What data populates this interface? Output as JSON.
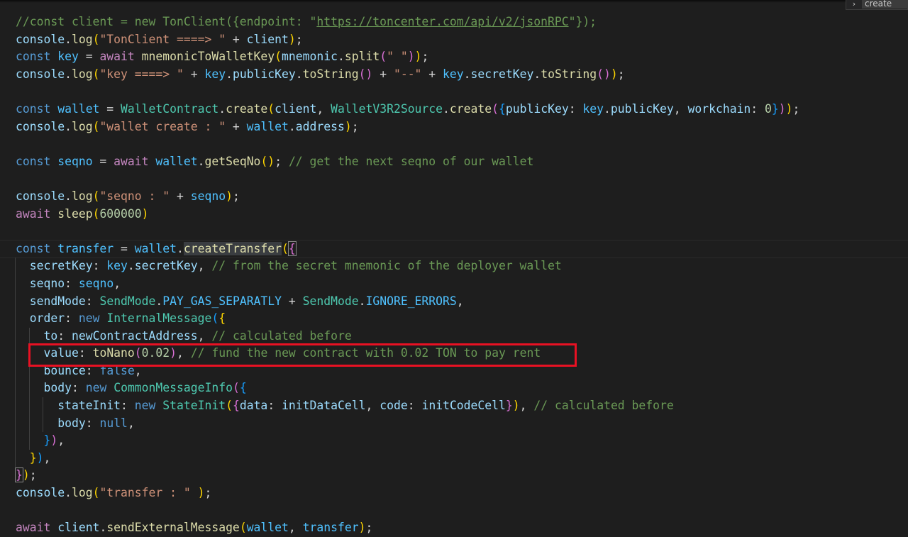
{
  "find_widget": {
    "toggle_icon": "chevron-right-icon",
    "value": "create"
  },
  "colors": {
    "background": "#1e1e1e",
    "comment": "#6a9955",
    "keyword": "#569cd6",
    "control": "#c586c0",
    "variable": "#9cdcfe",
    "constant": "#4fc1ff",
    "function": "#dcdcaa",
    "class": "#4ec9b0",
    "string": "#ce9178",
    "number": "#b5cea8",
    "highlight_box": "#e81123"
  },
  "code_lines": [
    [
      [
        "cm",
        "//const client = new TonClient({endpoint: \""
      ],
      [
        "cm ul",
        "https://toncenter.com/api/v2/jsonRPC"
      ],
      [
        "cm",
        "\"});"
      ]
    ],
    [
      [
        "var",
        "console"
      ],
      [
        "pl",
        "."
      ],
      [
        "fn",
        "log"
      ],
      [
        "b1",
        "("
      ],
      [
        "str",
        "\"TonClient ====> \""
      ],
      [
        "pl",
        " + "
      ],
      [
        "var",
        "client"
      ],
      [
        "b1",
        ")"
      ],
      [
        "pl",
        ";"
      ]
    ],
    [
      [
        "kw",
        "const "
      ],
      [
        "const",
        "key"
      ],
      [
        "pl",
        " = "
      ],
      [
        "ctl",
        "await "
      ],
      [
        "fn",
        "mnemonicToWalletKey"
      ],
      [
        "b1",
        "("
      ],
      [
        "var",
        "mnemonic"
      ],
      [
        "pl",
        "."
      ],
      [
        "fn",
        "split"
      ],
      [
        "b2",
        "("
      ],
      [
        "str",
        "\" \""
      ],
      [
        "b2",
        ")"
      ],
      [
        "b1",
        ")"
      ],
      [
        "pl",
        ";"
      ]
    ],
    [
      [
        "var",
        "console"
      ],
      [
        "pl",
        "."
      ],
      [
        "fn",
        "log"
      ],
      [
        "b1",
        "("
      ],
      [
        "str",
        "\"key ====> \""
      ],
      [
        "pl",
        " + "
      ],
      [
        "const",
        "key"
      ],
      [
        "pl",
        "."
      ],
      [
        "var",
        "publicKey"
      ],
      [
        "pl",
        "."
      ],
      [
        "fn",
        "toString"
      ],
      [
        "b2",
        "()"
      ],
      [
        "pl",
        " + "
      ],
      [
        "str",
        "\"--\""
      ],
      [
        "pl",
        " + "
      ],
      [
        "const",
        "key"
      ],
      [
        "pl",
        "."
      ],
      [
        "var",
        "secretKey"
      ],
      [
        "pl",
        "."
      ],
      [
        "fn",
        "toString"
      ],
      [
        "b2",
        "()"
      ],
      [
        "b1",
        ")"
      ],
      [
        "pl",
        ";"
      ]
    ],
    [],
    [
      [
        "kw",
        "const "
      ],
      [
        "const",
        "wallet"
      ],
      [
        "pl",
        " = "
      ],
      [
        "cls",
        "WalletContract"
      ],
      [
        "pl",
        "."
      ],
      [
        "fn",
        "create"
      ],
      [
        "b1",
        "("
      ],
      [
        "var",
        "client"
      ],
      [
        "pl",
        ", "
      ],
      [
        "cls",
        "WalletV3R2Source"
      ],
      [
        "pl",
        "."
      ],
      [
        "fn",
        "create"
      ],
      [
        "b2",
        "("
      ],
      [
        "b3",
        "{"
      ],
      [
        "var",
        "publicKey"
      ],
      [
        "pl",
        ": "
      ],
      [
        "const",
        "key"
      ],
      [
        "pl",
        "."
      ],
      [
        "var",
        "publicKey"
      ],
      [
        "pl",
        ", "
      ],
      [
        "var",
        "workchain"
      ],
      [
        "pl",
        ": "
      ],
      [
        "num",
        "0"
      ],
      [
        "b3",
        "}"
      ],
      [
        "b2",
        ")"
      ],
      [
        "b1",
        ")"
      ],
      [
        "pl",
        ";"
      ]
    ],
    [
      [
        "var",
        "console"
      ],
      [
        "pl",
        "."
      ],
      [
        "fn",
        "log"
      ],
      [
        "b1",
        "("
      ],
      [
        "str",
        "\"wallet create : \""
      ],
      [
        "pl",
        " + "
      ],
      [
        "const",
        "wallet"
      ],
      [
        "pl",
        "."
      ],
      [
        "var",
        "address"
      ],
      [
        "b1",
        ")"
      ],
      [
        "pl",
        ";"
      ]
    ],
    [],
    [
      [
        "kw",
        "const "
      ],
      [
        "const",
        "seqno"
      ],
      [
        "pl",
        " = "
      ],
      [
        "ctl",
        "await "
      ],
      [
        "const",
        "wallet"
      ],
      [
        "pl",
        "."
      ],
      [
        "fn",
        "getSeqNo"
      ],
      [
        "b1",
        "()"
      ],
      [
        "pl",
        "; "
      ],
      [
        "cm",
        "// get the next seqno of our wallet"
      ]
    ],
    [],
    [
      [
        "var",
        "console"
      ],
      [
        "pl",
        "."
      ],
      [
        "fn",
        "log"
      ],
      [
        "b1",
        "("
      ],
      [
        "str",
        "\"seqno : \""
      ],
      [
        "pl",
        " + "
      ],
      [
        "const",
        "seqno"
      ],
      [
        "b1",
        ")"
      ],
      [
        "pl",
        ";"
      ]
    ],
    [
      [
        "ctl",
        "await "
      ],
      [
        "fn",
        "sleep"
      ],
      [
        "b1",
        "("
      ],
      [
        "num",
        "600000"
      ],
      [
        "b1",
        ")"
      ]
    ],
    [],
    [
      [
        "kw",
        "const "
      ],
      [
        "const",
        "transfer"
      ],
      [
        "pl",
        " = "
      ],
      [
        "const",
        "wallet"
      ],
      [
        "pl",
        "."
      ],
      [
        "fn wordhl",
        "createTransfer"
      ],
      [
        "b1",
        "("
      ],
      [
        "b2 match",
        "{"
      ]
    ],
    [
      [
        "pl",
        "  "
      ],
      [
        "var",
        "secretKey"
      ],
      [
        "pl",
        ": "
      ],
      [
        "const",
        "key"
      ],
      [
        "pl",
        "."
      ],
      [
        "var",
        "secretKey"
      ],
      [
        "pl",
        ", "
      ],
      [
        "cm",
        "// from the secret mnemonic of the deployer wallet"
      ]
    ],
    [
      [
        "pl",
        "  "
      ],
      [
        "var",
        "seqno"
      ],
      [
        "pl",
        ": "
      ],
      [
        "const",
        "seqno"
      ],
      [
        "pl",
        ","
      ]
    ],
    [
      [
        "pl",
        "  "
      ],
      [
        "var",
        "sendMode"
      ],
      [
        "pl",
        ": "
      ],
      [
        "cls",
        "SendMode"
      ],
      [
        "pl",
        "."
      ],
      [
        "const",
        "PAY_GAS_SEPARATLY"
      ],
      [
        "pl",
        " + "
      ],
      [
        "cls",
        "SendMode"
      ],
      [
        "pl",
        "."
      ],
      [
        "const",
        "IGNORE_ERRORS"
      ],
      [
        "pl",
        ","
      ]
    ],
    [
      [
        "pl",
        "  "
      ],
      [
        "var",
        "order"
      ],
      [
        "pl",
        ": "
      ],
      [
        "kw",
        "new "
      ],
      [
        "cls",
        "InternalMessage"
      ],
      [
        "b3",
        "("
      ],
      [
        "b1",
        "{"
      ]
    ],
    [
      [
        "pl",
        "    "
      ],
      [
        "var",
        "to"
      ],
      [
        "pl",
        ": "
      ],
      [
        "var",
        "newContractAddress"
      ],
      [
        "pl",
        ", "
      ],
      [
        "cm",
        "// calculated before"
      ]
    ],
    [
      [
        "pl",
        "    "
      ],
      [
        "var",
        "value"
      ],
      [
        "pl",
        ": "
      ],
      [
        "fn",
        "toNano"
      ],
      [
        "b2",
        "("
      ],
      [
        "num",
        "0.02"
      ],
      [
        "b2",
        ")"
      ],
      [
        "pl",
        ", "
      ],
      [
        "cm",
        "// fund the new contract with 0.02 TON to pay rent"
      ]
    ],
    [
      [
        "pl",
        "    "
      ],
      [
        "var",
        "bounce"
      ],
      [
        "pl",
        ": "
      ],
      [
        "kw",
        "false"
      ],
      [
        "pl",
        ","
      ]
    ],
    [
      [
        "pl",
        "    "
      ],
      [
        "var",
        "body"
      ],
      [
        "pl",
        ": "
      ],
      [
        "kw",
        "new "
      ],
      [
        "cls",
        "CommonMessageInfo"
      ],
      [
        "b2",
        "("
      ],
      [
        "b3",
        "{"
      ]
    ],
    [
      [
        "pl",
        "      "
      ],
      [
        "var",
        "stateInit"
      ],
      [
        "pl",
        ": "
      ],
      [
        "kw",
        "new "
      ],
      [
        "cls",
        "StateInit"
      ],
      [
        "b1",
        "("
      ],
      [
        "b2",
        "{"
      ],
      [
        "var",
        "data"
      ],
      [
        "pl",
        ": "
      ],
      [
        "var",
        "initDataCell"
      ],
      [
        "pl",
        ", "
      ],
      [
        "var",
        "code"
      ],
      [
        "pl",
        ": "
      ],
      [
        "var",
        "initCodeCell"
      ],
      [
        "b2",
        "}"
      ],
      [
        "b1",
        ")"
      ],
      [
        "pl",
        ", "
      ],
      [
        "cm",
        "// calculated before"
      ]
    ],
    [
      [
        "pl",
        "      "
      ],
      [
        "var",
        "body"
      ],
      [
        "pl",
        ": "
      ],
      [
        "kw",
        "null"
      ],
      [
        "pl",
        ","
      ]
    ],
    [
      [
        "pl",
        "    "
      ],
      [
        "b3",
        "}"
      ],
      [
        "b2",
        ")"
      ],
      [
        "pl",
        ","
      ]
    ],
    [
      [
        "pl",
        "  "
      ],
      [
        "b1",
        "}"
      ],
      [
        "b3",
        ")"
      ],
      [
        "pl",
        ","
      ]
    ],
    [
      [
        "b2 match",
        "}"
      ],
      [
        "b1",
        ")"
      ],
      [
        "pl",
        ";"
      ]
    ],
    [
      [
        "var",
        "console"
      ],
      [
        "pl",
        "."
      ],
      [
        "fn",
        "log"
      ],
      [
        "b1",
        "("
      ],
      [
        "str",
        "\"transfer : \""
      ],
      [
        "pl",
        " "
      ],
      [
        "b1",
        ")"
      ],
      [
        "pl",
        ";"
      ]
    ],
    [],
    [
      [
        "ctl",
        "await "
      ],
      [
        "var",
        "client"
      ],
      [
        "pl",
        "."
      ],
      [
        "fn",
        "sendExternalMessage"
      ],
      [
        "b1",
        "("
      ],
      [
        "const",
        "wallet"
      ],
      [
        "pl",
        ", "
      ],
      [
        "const",
        "transfer"
      ],
      [
        "b1",
        ")"
      ],
      [
        "pl",
        ";"
      ]
    ]
  ]
}
